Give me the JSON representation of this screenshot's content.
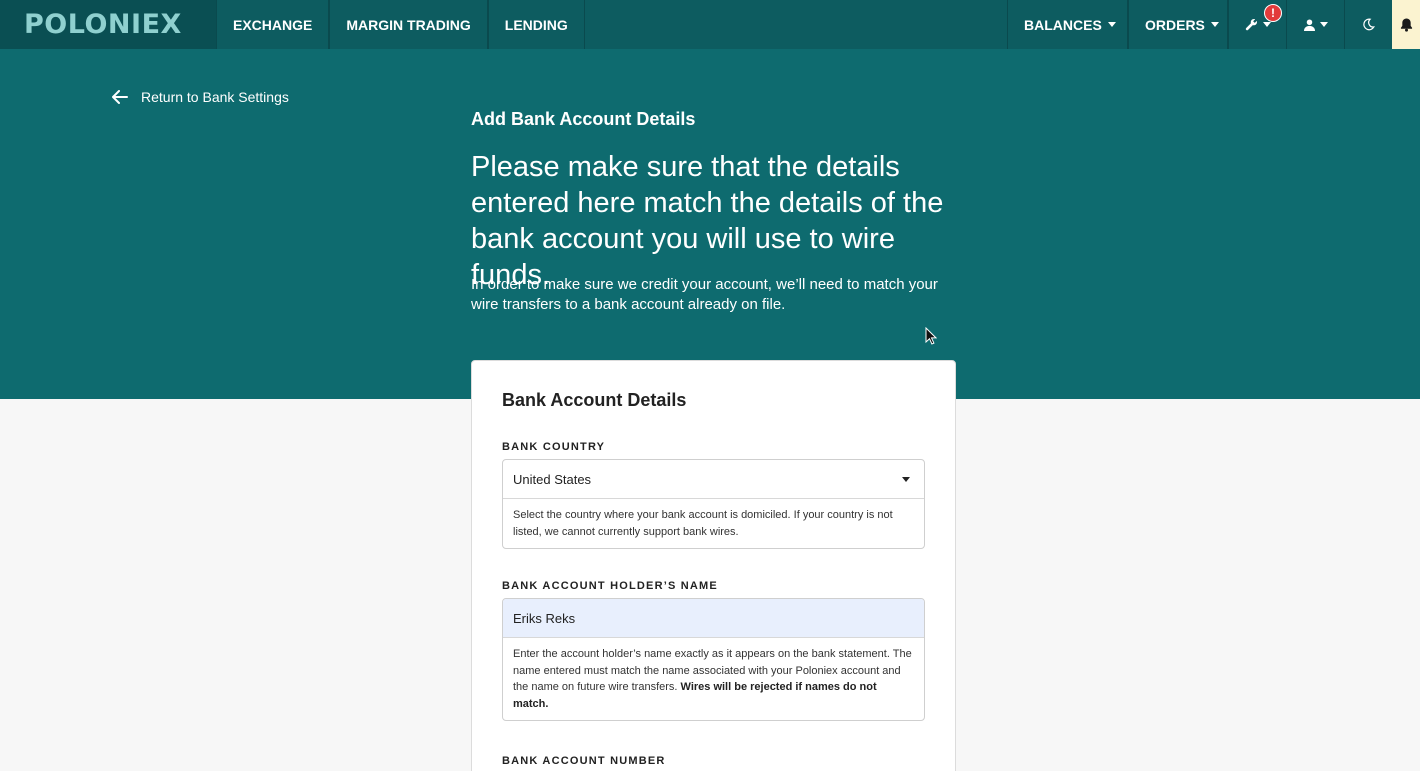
{
  "nav": {
    "logo": "POLONIEX",
    "left_items": [
      "EXCHANGE",
      "MARGIN TRADING",
      "LENDING"
    ],
    "balances": "BALANCES",
    "orders": "ORDERS",
    "alert_badge": "!"
  },
  "hero": {
    "back_link": "Return to Bank Settings",
    "subtitle": "Add Bank Account Details",
    "headline": "Please make sure that the details entered here match the details of the bank account you will use to wire funds.",
    "intro": "In order to make sure we credit your account, we’ll need to match your wire transfers to a bank account already on file."
  },
  "card": {
    "title": "Bank Account Details",
    "country": {
      "label": "BANK COUNTRY",
      "value": "United States",
      "help": "Select the country where your bank account is domiciled. If your country is not listed, we cannot currently support bank wires."
    },
    "holder": {
      "label": "BANK ACCOUNT HOLDER’S NAME",
      "value": "Eriks Reks",
      "help": "Enter the account holder’s name exactly as it appears on the bank statement. The name entered must match the name associated with your Poloniex account and the name on future wire transfers.",
      "help_bold": "Wires will be rejected if names do not match."
    },
    "account_number": {
      "label": "BANK ACCOUNT NUMBER"
    }
  }
}
